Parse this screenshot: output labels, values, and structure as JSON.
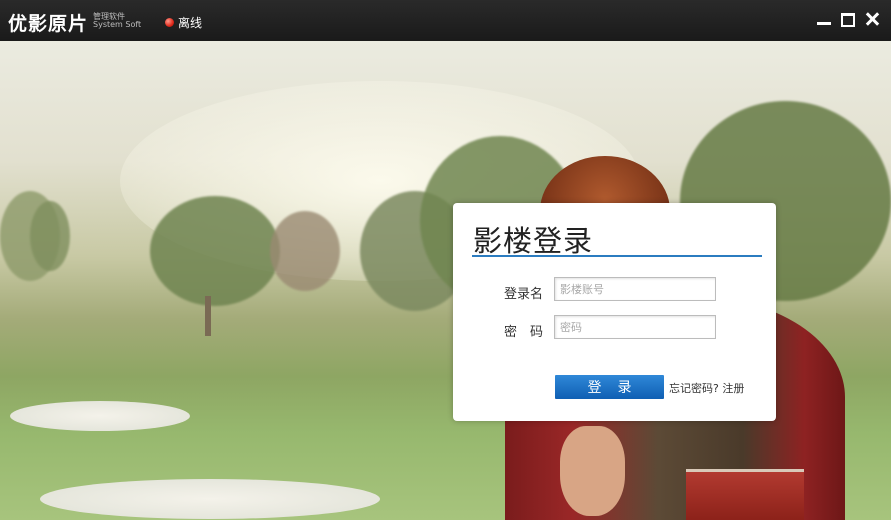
{
  "app": {
    "brand": "优影原片",
    "brand_sub_line1": "管理软件",
    "brand_sub_line2": "System Soft",
    "status_text": "离线",
    "status_color": "#e0281a"
  },
  "window_controls": {
    "minimize_icon": "minimize-icon",
    "maximize_icon": "maximize-icon",
    "close_icon": "close-icon"
  },
  "login": {
    "title": "影楼登录",
    "username_label": "登录名",
    "username_placeholder": "影楼账号",
    "username_value": "",
    "password_label": "密　码",
    "password_placeholder": "密码",
    "password_value": "",
    "login_button": "登录",
    "forgot_link": "忘记密码?",
    "register_link": "注册",
    "accent_color": "#2b7cc0"
  }
}
